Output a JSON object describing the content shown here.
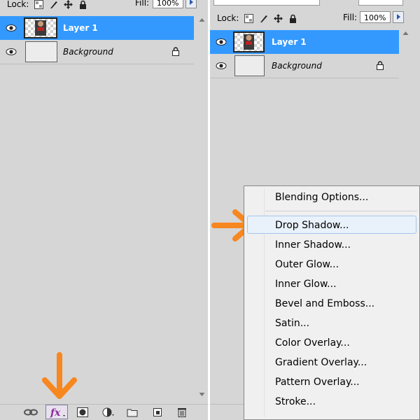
{
  "left_panel": {
    "lock_label": "Lock:",
    "fill_label": "Fill:",
    "fill_value": "100%",
    "layers": [
      {
        "name": "Layer 1",
        "selected": true
      },
      {
        "name": "Background",
        "selected": false,
        "locked": true
      }
    ],
    "bottom_icons": [
      "link-icon",
      "fx-icon",
      "mask-icon",
      "adjustment-icon",
      "folder-icon",
      "new-layer-icon",
      "trash-icon"
    ]
  },
  "right_panel": {
    "lock_label": "Lock:",
    "fill_label": "Fill:",
    "fill_value": "100%",
    "layers": [
      {
        "name": "Layer 1",
        "selected": true
      },
      {
        "name": "Background",
        "selected": false,
        "locked": true
      }
    ]
  },
  "fx_menu": {
    "items": [
      "Blending Options...",
      "Drop Shadow...",
      "Inner Shadow...",
      "Outer Glow...",
      "Inner Glow...",
      "Bevel and Emboss...",
      "Satin...",
      "Color Overlay...",
      "Gradient Overlay...",
      "Pattern Overlay...",
      "Stroke..."
    ],
    "highlighted": "Drop Shadow..."
  },
  "colors": {
    "selection": "#3399ff",
    "annotation_arrow": "#f7871f",
    "panel_bg": "#d6d6d6"
  }
}
